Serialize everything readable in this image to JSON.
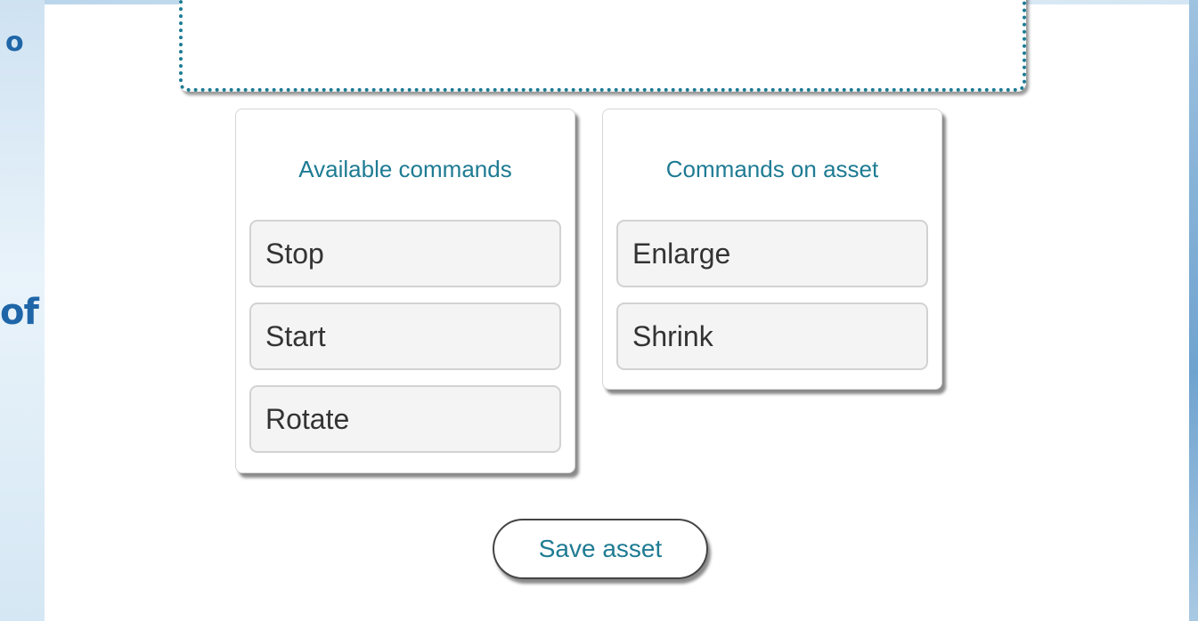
{
  "background_fragments": {
    "top_text": "o",
    "middle_text": "of"
  },
  "available_commands": {
    "title": "Available commands",
    "items": [
      {
        "label": "Stop"
      },
      {
        "label": "Start"
      },
      {
        "label": "Rotate"
      }
    ]
  },
  "commands_on_asset": {
    "title": "Commands on asset",
    "items": [
      {
        "label": "Enlarge"
      },
      {
        "label": "Shrink"
      }
    ]
  },
  "actions": {
    "save_label": "Save asset"
  },
  "colors": {
    "accent": "#1e7b93",
    "slide_text": "#1f66a8",
    "item_background": "#f4f4f4"
  }
}
